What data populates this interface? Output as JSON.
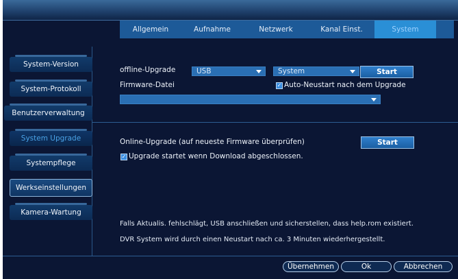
{
  "tabs": [
    {
      "label": "Allgemein"
    },
    {
      "label": "Aufnahme"
    },
    {
      "label": "Netzwerk"
    },
    {
      "label": "Kanal Einst."
    },
    {
      "label": "System"
    }
  ],
  "sidebar": {
    "items": [
      {
        "label": "System-Version"
      },
      {
        "label": "System-Protokoll"
      },
      {
        "label": "Benutzerverwaltung"
      },
      {
        "label": "System Upgrade"
      },
      {
        "label": "Systempflege"
      },
      {
        "label": "Werkseinstellungen"
      },
      {
        "label": "Kamera-Wartung"
      }
    ]
  },
  "offline": {
    "label": "offline-Upgrade",
    "source_select": "USB",
    "type_select": "System",
    "start_label": "Start",
    "firmware_label": "Firmware-Datei",
    "auto_restart_label": "Auto-Neustart nach dem Upgrade",
    "auto_restart_checked": true,
    "firmware_file": ""
  },
  "online": {
    "label": "Online-Upgrade (auf neueste Firmware überprüfen)",
    "start_label": "Start",
    "auto_upgrade_label": "Upgrade startet wenn Download abgeschlossen.",
    "auto_upgrade_checked": true
  },
  "notes": {
    "line1": "Falls Aktualis. fehlschlägt, USB anschließen und sicherstellen, dass help.rom existiert.",
    "line2": "DVR System wird durch einen Neustart nach ca. 3 Minuten wiederhergestellt."
  },
  "footer": {
    "apply_label": "Übernehmen",
    "ok_label": "Ok",
    "cancel_label": "Abbrechen"
  },
  "colors": {
    "background": "#0b1634",
    "tab_bar": "#1d5a98",
    "active_tab": "#2a8fd6",
    "active_sidebar_text": "#4aa3e8"
  }
}
